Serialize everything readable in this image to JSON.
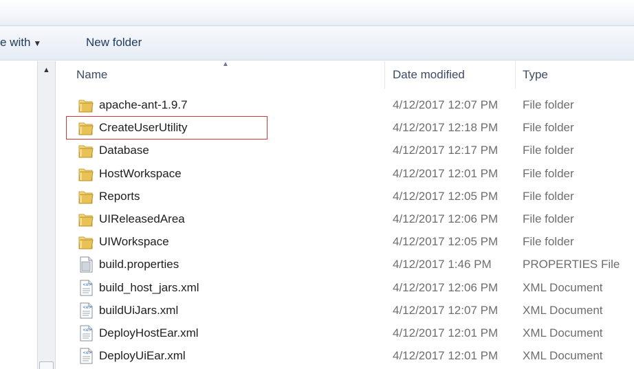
{
  "toolbar": {
    "open_with_label": "e with",
    "open_with_caret": "▼",
    "new_folder_label": "New folder"
  },
  "columns": {
    "name": "Name",
    "date_modified": "Date modified",
    "type": "Type",
    "sort_indicator": "▲"
  },
  "scrollbar": {
    "up_arrow": "▲"
  },
  "files": [
    {
      "name": "apache-ant-1.9.7",
      "date": "4/12/2017 12:07 PM",
      "type": "File folder",
      "icon": "folder-icon"
    },
    {
      "name": "CreateUserUtility",
      "date": "4/12/2017 12:18 PM",
      "type": "File folder",
      "icon": "folder-icon",
      "highlighted": true
    },
    {
      "name": "Database",
      "date": "4/12/2017 12:17 PM",
      "type": "File folder",
      "icon": "folder-icon"
    },
    {
      "name": "HostWorkspace",
      "date": "4/12/2017 12:01 PM",
      "type": "File folder",
      "icon": "folder-icon"
    },
    {
      "name": "Reports",
      "date": "4/12/2017 12:05 PM",
      "type": "File folder",
      "icon": "folder-icon"
    },
    {
      "name": "UIReleasedArea",
      "date": "4/12/2017 12:06 PM",
      "type": "File folder",
      "icon": "folder-icon"
    },
    {
      "name": "UIWorkspace",
      "date": "4/12/2017 12:05 PM",
      "type": "File folder",
      "icon": "folder-icon"
    },
    {
      "name": "build.properties",
      "date": "4/12/2017 1:46 PM",
      "type": "PROPERTIES File",
      "icon": "properties-file-icon"
    },
    {
      "name": "build_host_jars.xml",
      "date": "4/12/2017 12:06 PM",
      "type": "XML Document",
      "icon": "xml-file-icon"
    },
    {
      "name": "buildUiJars.xml",
      "date": "4/12/2017 12:07 PM",
      "type": "XML Document",
      "icon": "xml-file-icon"
    },
    {
      "name": "DeployHostEar.xml",
      "date": "4/12/2017 12:01 PM",
      "type": "XML Document",
      "icon": "xml-file-icon"
    },
    {
      "name": "DeployUiEar.xml",
      "date": "4/12/2017 12:01 PM",
      "type": "XML Document",
      "icon": "xml-file-icon"
    }
  ],
  "colors": {
    "highlight_border": "#d9333a",
    "folder_yellow": "#e8c257"
  }
}
